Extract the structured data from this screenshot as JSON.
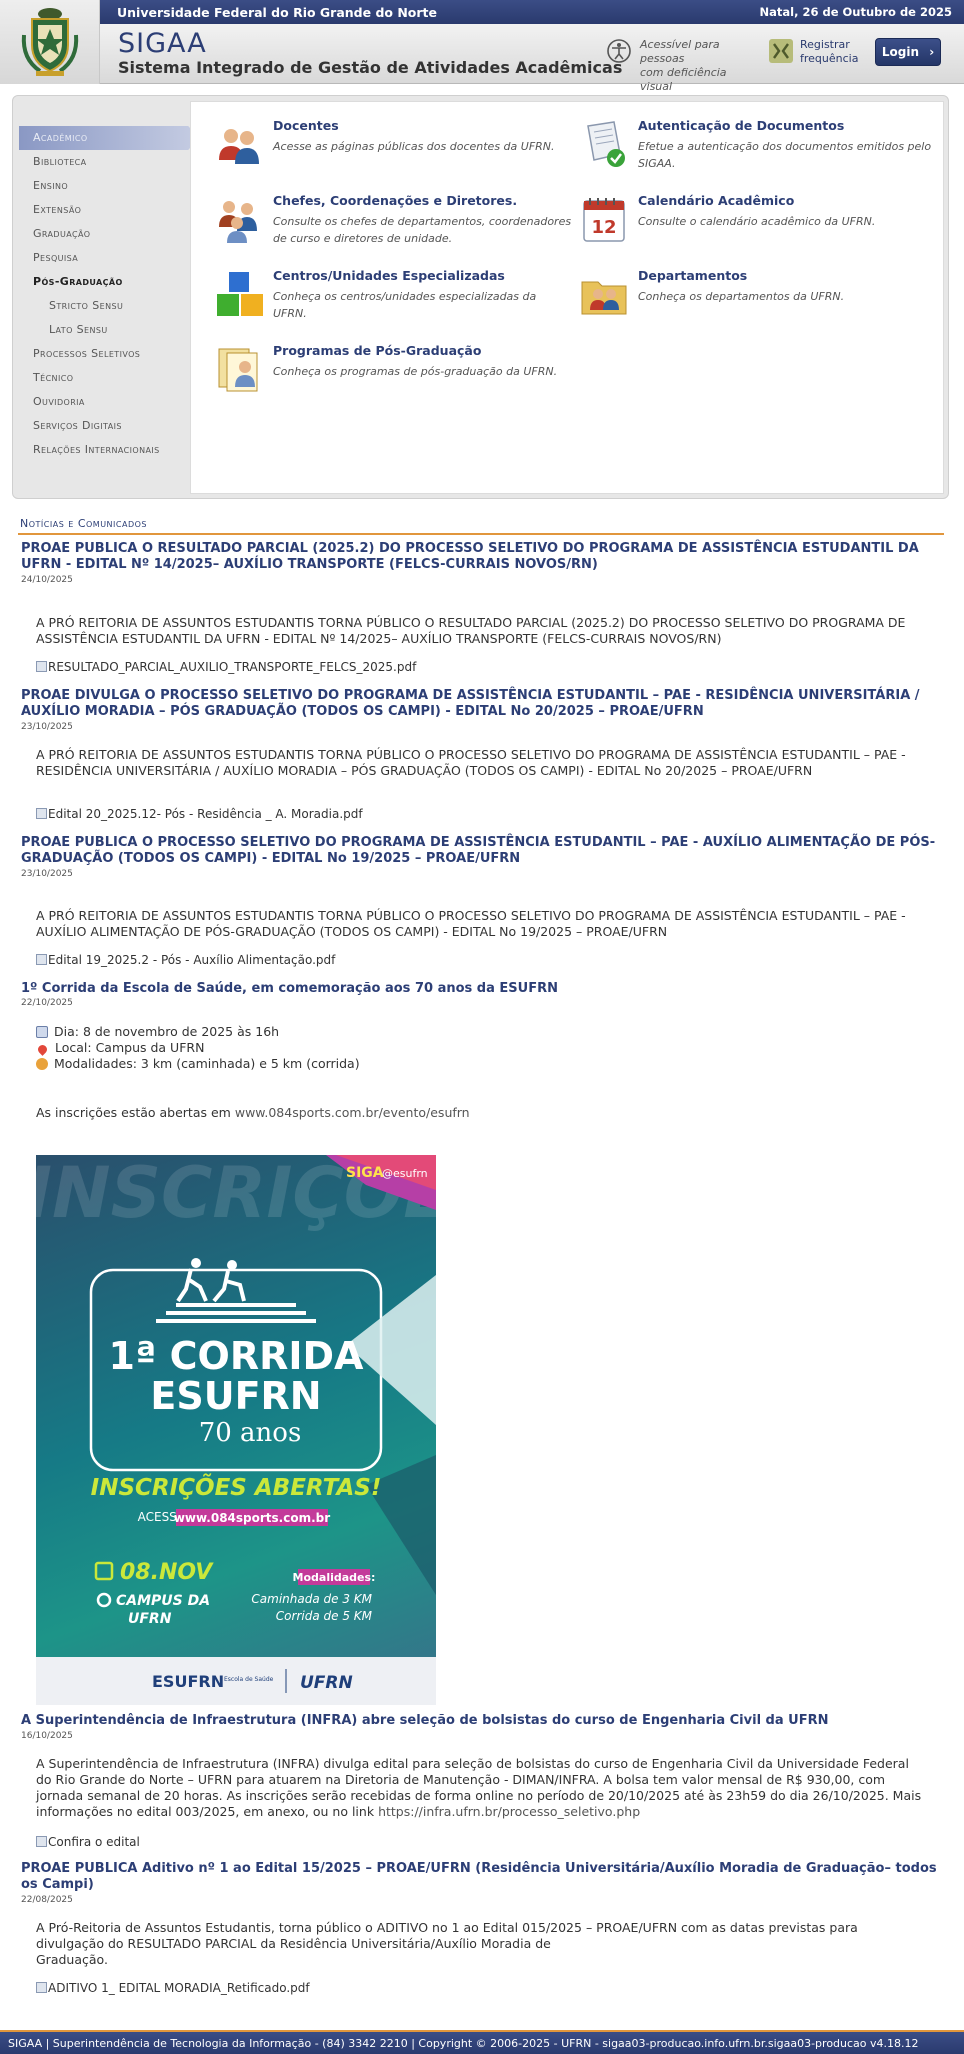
{
  "topbar": {
    "university": "Universidade Federal do Rio Grande do Norte",
    "date": "Natal, 26 de Outubro de 2025"
  },
  "brand": {
    "name": "SIGAA",
    "subtitle": "Sistema Integrado de Gestão de Atividades Acadêmicas"
  },
  "accessibility": {
    "line1": "Acessível para pessoas",
    "line2": "com deficiência visual"
  },
  "frequency": {
    "line1": "Registrar",
    "line2": "frequência"
  },
  "login": {
    "label": "Login",
    "icon": "chevron-right-icon"
  },
  "menu": [
    {
      "label": "Acadêmico",
      "state": "active"
    },
    {
      "label": "Biblioteca"
    },
    {
      "label": "Ensino"
    },
    {
      "label": "Extensão"
    },
    {
      "label": "Graduação"
    },
    {
      "label": "Pesquisa"
    },
    {
      "label": "Pós-Graduação",
      "state": "bold"
    },
    {
      "label": "Stricto Sensu",
      "state": "sub"
    },
    {
      "label": "Lato Sensu",
      "state": "sub"
    },
    {
      "label": "Processos Seletivos"
    },
    {
      "label": "Técnico"
    },
    {
      "label": "Ouvidoria"
    },
    {
      "label": "Serviços Digitais"
    },
    {
      "label": "Relações Internacionais"
    }
  ],
  "cards": [
    {
      "title": "Docentes",
      "desc": "Acesse as páginas públicas dos docentes da UFRN.",
      "icon": "teachers-icon"
    },
    {
      "title": "Autenticação de Documentos",
      "desc": "Efetue a autenticação dos documentos emitidos pelo SIGAA.",
      "icon": "document-check-icon"
    },
    {
      "title": "Chefes, Coordenações e Diretores.",
      "desc": "Consulte os chefes de departamentos, coordenadores de curso e diretores de unidade.",
      "icon": "people-group-icon"
    },
    {
      "title": "Calendário Acadêmico",
      "desc": "Consulte o calendário acadêmico da UFRN.",
      "icon": "calendar-icon",
      "icon_text": "12"
    },
    {
      "title": "Centros/Unidades Especializadas",
      "desc": "Conheça os centros/unidades especializadas da UFRN.",
      "icon": "cubes-icon"
    },
    {
      "title": "Departamentos",
      "desc": "Conheça os departamentos da UFRN.",
      "icon": "folder-people-icon"
    },
    {
      "title": "Programas de Pós-Graduação",
      "desc": "Conheça os programas de pós-graduação da UFRN.",
      "icon": "documents-person-icon"
    }
  ],
  "news_heading": "Notícias e Comunicados",
  "news": [
    {
      "title": "PROAE PUBLICA O RESULTADO PARCIAL (2025.2) DO PROCESSO SELETIVO DO PROGRAMA DE ASSISTÊNCIA ESTUDANTIL DA UFRN - EDITAL Nº 14/2025– AUXÍLIO TRANSPORTE (FELCS-CURRAIS NOVOS/RN)",
      "date": "24/10/2025",
      "body": "A PRÓ REITORIA DE ASSUNTOS ESTUDANTIS TORNA PÚBLICO O RESULTADO PARCIAL (2025.2) DO PROCESSO SELETIVO DO PROGRAMA DE ASSISTÊNCIA ESTUDANTIL DA UFRN - EDITAL Nº 14/2025– AUXÍLIO TRANSPORTE (FELCS-CURRAIS NOVOS/RN)",
      "attachment": "RESULTADO_PARCIAL_AUXILIO_TRANSPORTE_FELCS_2025.pdf"
    },
    {
      "title": "PROAE DIVULGA O PROCESSO SELETIVO DO PROGRAMA DE ASSISTÊNCIA ESTUDANTIL – PAE - RESIDÊNCIA UNIVERSITÁRIA / AUXÍLIO MORADIA – PÓS GRADUAÇÃO (TODOS OS CAMPI) - EDITAL No 20/2025 – PROAE/UFRN",
      "date": "23/10/2025",
      "body": "A PRÓ REITORIA DE ASSUNTOS ESTUDANTIS TORNA PÚBLICO O PROCESSO SELETIVO DO PROGRAMA DE ASSISTÊNCIA ESTUDANTIL – PAE - RESIDÊNCIA UNIVERSITÁRIA / AUXÍLIO MORADIA – PÓS GRADUAÇÃO (TODOS OS CAMPI) - EDITAL No 20/2025 – PROAE/UFRN",
      "attachment": "Edital 20_2025.12- Pós - Residência _ A. Moradia.pdf"
    },
    {
      "title": "PROAE PUBLICA O PROCESSO SELETIVO DO PROGRAMA DE ASSISTÊNCIA ESTUDANTIL – PAE - AUXÍLIO ALIMENTAÇÃO DE PÓS-GRADUAÇÃO (TODOS OS CAMPI) - EDITAL No 19/2025 – PROAE/UFRN",
      "date": "23/10/2025",
      "body": "A PRÓ REITORIA DE ASSUNTOS ESTUDANTIS TORNA PÚBLICO O PROCESSO SELETIVO DO PROGRAMA DE ASSISTÊNCIA ESTUDANTIL – PAE - AUXÍLIO ALIMENTAÇÃO  DE PÓS-GRADUAÇÃO (TODOS OS CAMPI) - EDITAL No 19/2025 – PROAE/UFRN",
      "attachment": "Edital 19_2025.2 - Pós - Auxílio Alimentação.pdf"
    },
    {
      "title": "1º Corrida da Escola de Saúde, em comemoração aos 70 anos da ESUFRN",
      "date": "22/10/2025",
      "bullets": [
        {
          "icon": "calendar-icon",
          "text": "Dia: 8 de novembro de 2025 às 16h"
        },
        {
          "icon": "pin-icon",
          "text": "Local: Campus da UFRN"
        },
        {
          "icon": "medal-icon",
          "text": "Modalidades: 3 km (caminhada) e 5 km (corrida)"
        }
      ],
      "registration_prefix": "As inscrições estão abertas em",
      "registration_link": "www.084sports.com.br/evento/esufrn",
      "poster": {
        "bg_word": "INSCRIÇÕE",
        "brand": "SIGA",
        "handle": "@esufrn",
        "line1": "1ª CORRIDA",
        "line2": "ESUFRN",
        "line3": "70 anos",
        "cta": "INSCRIÇÕES ABERTAS!",
        "access": "ACESSE",
        "url": "www.084sports.com.br",
        "date": "08.NOV",
        "place1": "CAMPUS DA",
        "place2": "UFRN",
        "mod_title": "Modalidades:",
        "mod1": "Caminhada de 3 KM",
        "mod2": "Corrida de 5 KM",
        "logo1": "ESUFRN",
        "logo1_sub": "Escola de Saúde",
        "logo2": "UFRN"
      }
    },
    {
      "title": "A Superintendência de Infraestrutura (INFRA) abre seleção de bolsistas do curso de Engenharia Civil da UFRN",
      "date": "16/10/2025",
      "body": "A Superintendência de Infraestrutura (INFRA) divulga edital para seleção de bolsistas do curso de Engenharia Civil da Universidade Federal do Rio Grande do Norte – UFRN para atuarem na Diretoria de Manutenção - DIMAN/INFRA. A bolsa tem valor mensal de R$ 930,00, com jornada semanal de 20 horas. As inscrições serão recebidas de forma online no período de 20/10/2025 até às 23h59 do dia 26/10/2025. Mais informações no edital 003/2025, em anexo, ou no link",
      "link": "https://infra.ufrn.br/processo_seletivo.php",
      "attachment": "Confira o edital"
    },
    {
      "title": "PROAE PUBLICA Aditivo nº 1 ao Edital 15/2025 – PROAE/UFRN (Residência Universitária/Auxílio Moradia de Graduação– todos os Campi)",
      "date": "22/08/2025",
      "body_lines": [
        "A Pró-Reitoria de Assuntos Estudantis, torna público o ADITIVO no 1 ao Edital 015/2025 – PROAE/UFRN com as datas previstas para",
        "divulgação do RESULTADO PARCIAL da Residência Universitária/Auxílio Moradia de",
        "Graduação."
      ],
      "attachment": "ADITIVO 1_ EDITAL MORADIA_Retificado.pdf"
    }
  ],
  "footer": "SIGAA | Superintendência de Tecnologia da Informação - (84) 3342 2210 | Copyright © 2006-2025 - UFRN - sigaa03-producao.info.ufrn.br.sigaa03-producao v4.18.12"
}
